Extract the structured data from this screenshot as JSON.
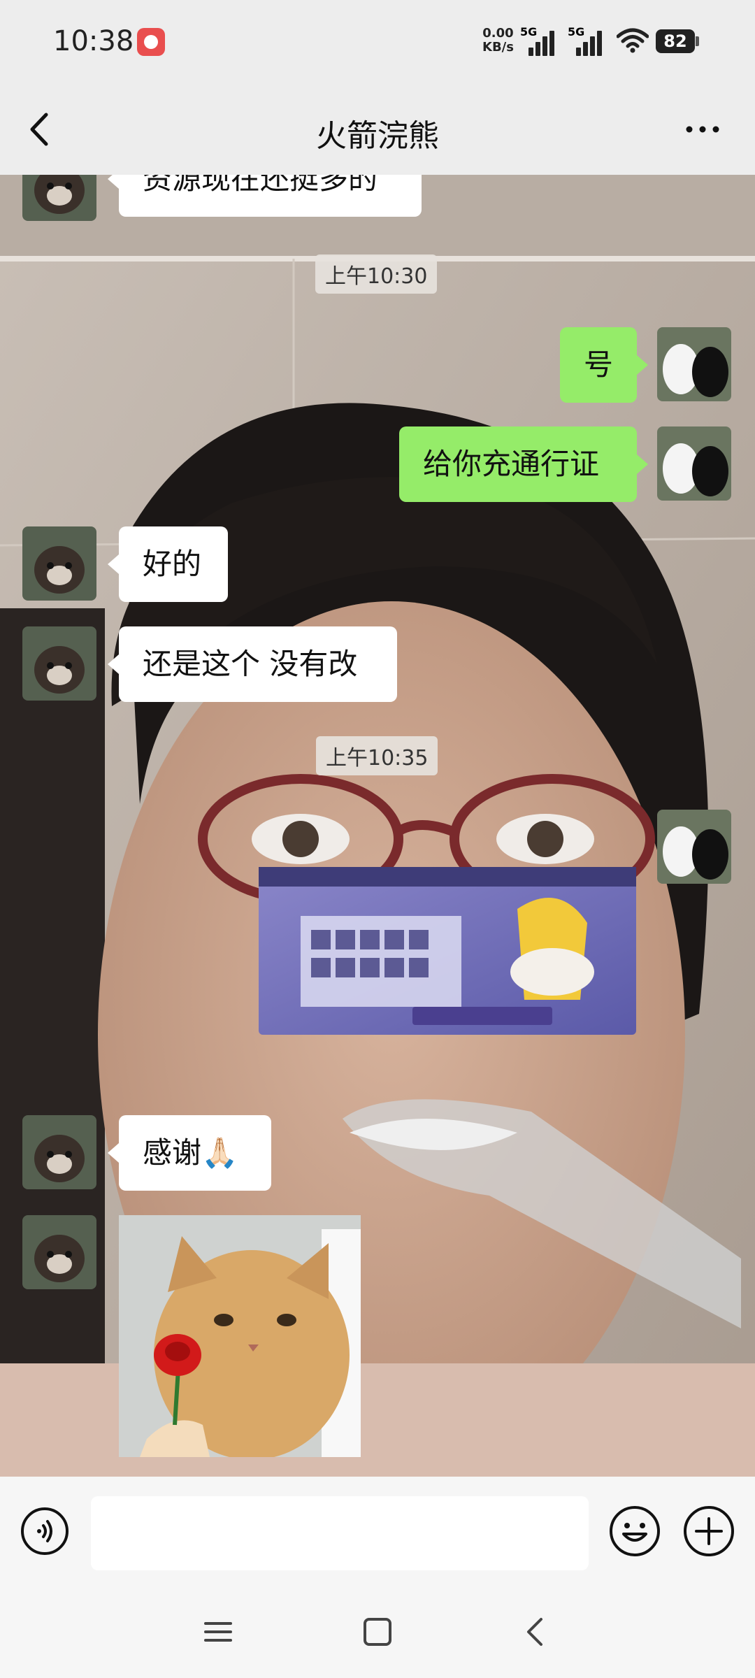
{
  "status_bar": {
    "time": "10:38",
    "net_speed_value": "0.00",
    "net_speed_unit": "KB/s",
    "sim1_label": "5G",
    "sim2_label": "5G",
    "battery": "82"
  },
  "header": {
    "title": "火箭浣熊",
    "back_icon": "chevron-left-icon",
    "more_icon": "more-horizontal-icon"
  },
  "messages": {
    "m0": "资源现在还挺多的",
    "ts1": "上午10:30",
    "m1": "号",
    "m2": "给你充通行证",
    "m3": "好的",
    "m4": "还是这个 没有改",
    "ts2": "上午10:35",
    "m5_image": "game-pass-screenshot",
    "m6": "感谢🙏🏻",
    "m7_image": "cat-holding-rose-sticker"
  },
  "input_bar": {
    "voice_icon": "voice-icon",
    "input_value": "",
    "emoji_icon": "emoji-icon",
    "plus_icon": "plus-circle-icon"
  },
  "nav_bar": {
    "menu_icon": "menu-icon",
    "home_icon": "home-square-icon",
    "back_icon": "back-icon"
  },
  "colors": {
    "outgoing_bubble": "#95ec69",
    "incoming_bubble": "#ffffff",
    "chrome_bg": "#ededed"
  }
}
